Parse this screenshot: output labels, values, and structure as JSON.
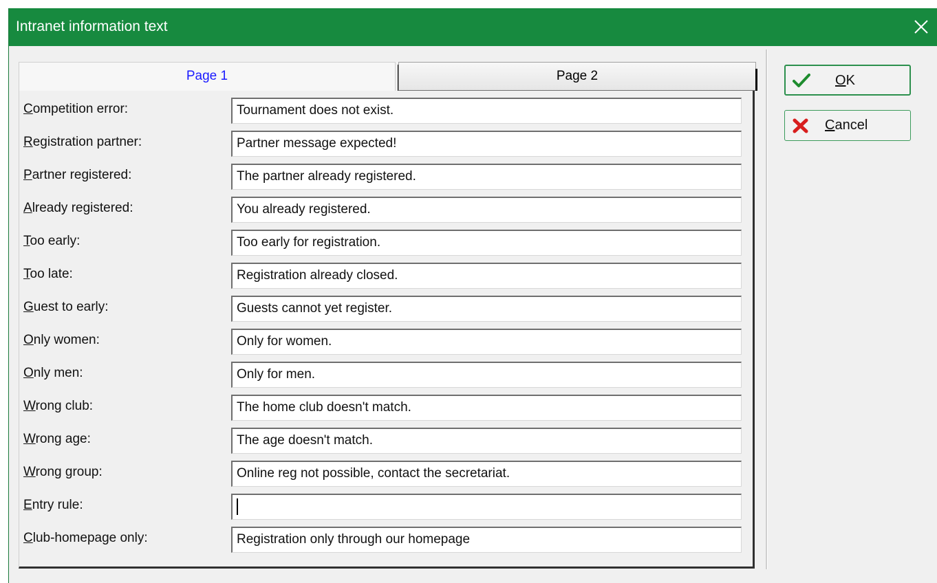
{
  "window": {
    "title": "Intranet information text",
    "titlebar_color": "#178a3f"
  },
  "tabs": [
    {
      "label": "Page 1",
      "active": true
    },
    {
      "label": "Page 2",
      "active": false
    }
  ],
  "fields": [
    {
      "key": "C",
      "rest": "ompetition error:",
      "value": "Tournament does not exist."
    },
    {
      "key": "R",
      "rest": "egistration partner:",
      "value": "Partner message expected!"
    },
    {
      "key": "P",
      "rest": "artner registered:",
      "value": "The partner already registered."
    },
    {
      "key": "A",
      "rest": "lready registered:",
      "value": "You already registered."
    },
    {
      "key": "T",
      "rest": "oo early:",
      "value": "Too early for registration."
    },
    {
      "key": "T",
      "rest": "oo late:",
      "value": "Registration already closed."
    },
    {
      "key": "G",
      "rest": "uest to early:",
      "value": "Guests cannot yet register."
    },
    {
      "key": "O",
      "rest": "nly women:",
      "value": "Only for women."
    },
    {
      "key": "O",
      "rest": "nly men:",
      "value": "Only for men."
    },
    {
      "key": "W",
      "rest": "rong club:",
      "value": "The home club doesn't match."
    },
    {
      "key": "W",
      "rest": "rong age:",
      "value": "The age doesn't match."
    },
    {
      "key": "W",
      "rest": "rong group:",
      "value": "Online reg not possible, contact the secretariat."
    },
    {
      "key": "E",
      "rest": "ntry rule:",
      "value": ""
    },
    {
      "key": "C",
      "rest": "lub-homepage only:",
      "value": "Registration only through our homepage"
    }
  ],
  "buttons": {
    "ok": {
      "key": "O",
      "rest": "K",
      "icon": "checkmark-icon"
    },
    "cancel": {
      "key": "C",
      "rest": "ancel",
      "icon": "red-x-icon"
    }
  }
}
